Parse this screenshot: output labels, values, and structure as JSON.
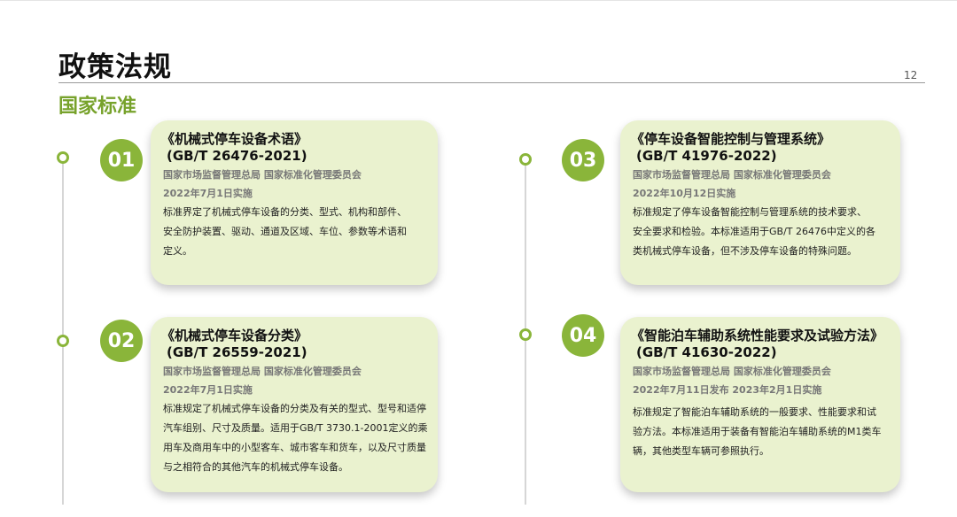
{
  "page": {
    "title": "政策法规",
    "number": "12",
    "section": "国家标准"
  },
  "standards": [
    {
      "number": "01",
      "title": "《机械式停车设备术语》",
      "code": "(GB/T 26476-2021)",
      "issuer": "国家市场监督管理总局  国家标准化管理委员会",
      "date": "2022年7月1日实施",
      "desc_lines": [
        "标准界定了机械式停车设备的分类、型式、机构和部件、",
        "安全防护装置、驱动、通道及区域、车位、参数等术语和",
        "定义。"
      ]
    },
    {
      "number": "02",
      "title": "《机械式停车设备分类》",
      "code": "(GB/T 26559-2021)",
      "issuer": "国家市场监督管理总局  国家标准化管理委员会",
      "date": "2022年7月1日实施",
      "desc_lines": [
        "标准规定了机械式停车设备的分类及有关的型式、型号和适停",
        "汽车组别、尺寸及质量。适用于GB/T 3730.1-2001定义的乘",
        "用车及商用车中的小型客车、城市客车和货车，以及尺寸质量",
        "与之相符合的其他汽车的机械式停车设备。"
      ]
    },
    {
      "number": "03",
      "title": "《停车设备智能控制与管理系统》",
      "code": "(GB/T 41976-2022)",
      "issuer": "国家市场监督管理总局  国家标准化管理委员会",
      "date": "2022年10月12日实施",
      "desc_lines": [
        "标准规定了停车设备智能控制与管理系统的技术要求、",
        "安全要求和检验。本标准适用于GB/T 26476中定义的各",
        "类机械式停车设备，但不涉及停车设备的特殊问题。"
      ]
    },
    {
      "number": "04",
      "title": "《智能泊车辅助系统性能要求及试验方法》",
      "code": "(GB/T 41630-2022)",
      "issuer": "国家市场监督管理总局  国家标准化管理委员会",
      "date": "2022年7月11日发布  2023年2月1日实施",
      "desc_lines": [
        "标准规定了智能泊车辅助系统的一般要求、性能要求和试",
        "验方法。本标准适用于装备有智能泊车辅助系统的M1类车",
        "辆，其他类型车辆可参照执行。"
      ]
    }
  ]
}
